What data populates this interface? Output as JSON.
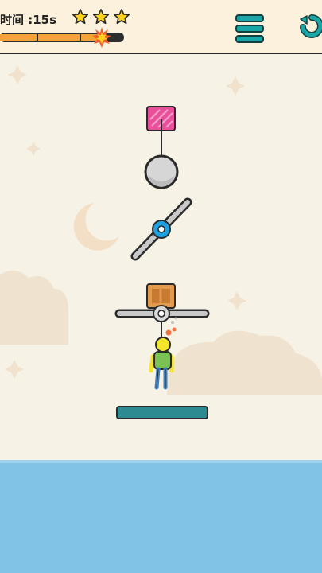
{
  "hud": {
    "timer_label": "时间 :15s",
    "stars_earned": 3,
    "stars_total": 3,
    "time_progress": 0.82
  },
  "icons": {
    "menu": "hamburger-menu-icon",
    "restart": "restart-icon",
    "star": "star-icon",
    "fuse_flame": "flame-icon"
  },
  "colors": {
    "hud_background": "#fbf1dc",
    "sky": "#f7f2e6",
    "star": "#ffd21f",
    "accent_teal": "#1aa5a6",
    "pin_blue": "#1da1e0",
    "weight_block": "#e8509a",
    "crate": "#e29a4c",
    "water": "#80c3e6",
    "platform": "#2e8a91"
  }
}
